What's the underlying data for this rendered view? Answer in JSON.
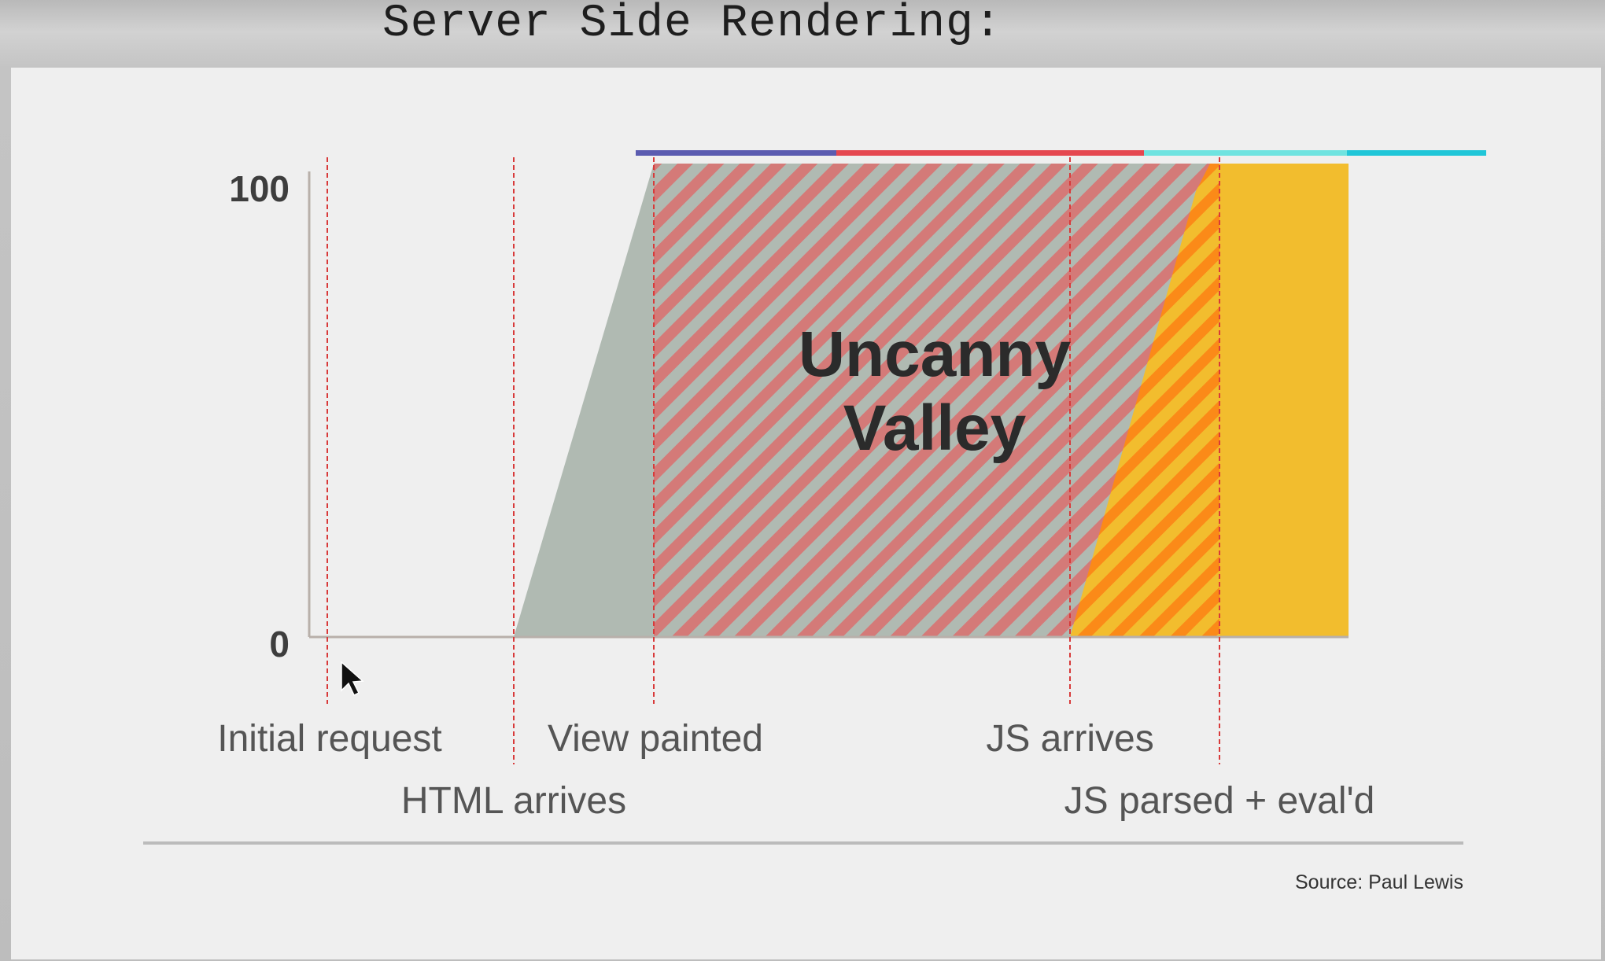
{
  "slide": {
    "title": "Server Side Rendering:",
    "source": "Source: Paul Lewis"
  },
  "colors": {
    "background_gradient": "#c8c8c8",
    "panel": "#efefef",
    "gray_area": "#b0bab2",
    "stripe_red": "#d47a78",
    "yellow_area": "#f2bd2e",
    "stripe_orange": "#fb8a18",
    "marker_line": "#d83a3a",
    "axis": "#b8b0aa",
    "top_bar": [
      "#5b5cb0",
      "#e54850",
      "#6fe3e0",
      "#20c6d8"
    ]
  },
  "chart_data": {
    "type": "area",
    "title": "",
    "xlabel": "",
    "ylabel": "",
    "ylim": [
      0,
      100
    ],
    "y_ticks": [
      "100",
      "0"
    ],
    "annotation": [
      "Uncanny",
      "Valley"
    ],
    "milestones": [
      {
        "label": "Initial request",
        "row": 1
      },
      {
        "label": "HTML arrives",
        "row": 2
      },
      {
        "label": "View painted",
        "row": 1
      },
      {
        "label": "JS arrives",
        "row": 1
      },
      {
        "label": "JS parsed + eval'd",
        "row": 2
      }
    ],
    "top_bar_segments": 4,
    "phases": [
      {
        "phase": "loading",
        "from_milestone": 1,
        "to_milestone": 2,
        "shape": "ramp 0 to 100",
        "fill": "gray_area"
      },
      {
        "phase": "uncanny valley",
        "from_milestone": 2,
        "to_milestone": 4,
        "value": 100,
        "fill": "gray_area with stripe_red hatch"
      },
      {
        "phase": "interactive",
        "from_milestone": 3,
        "to_milestone": 4,
        "shape": "ramp 0 to 100",
        "fill": "yellow_area with stripe_orange hatch"
      },
      {
        "phase": "ready",
        "from_milestone": 4,
        "value": 100,
        "fill": "yellow_area"
      }
    ]
  }
}
